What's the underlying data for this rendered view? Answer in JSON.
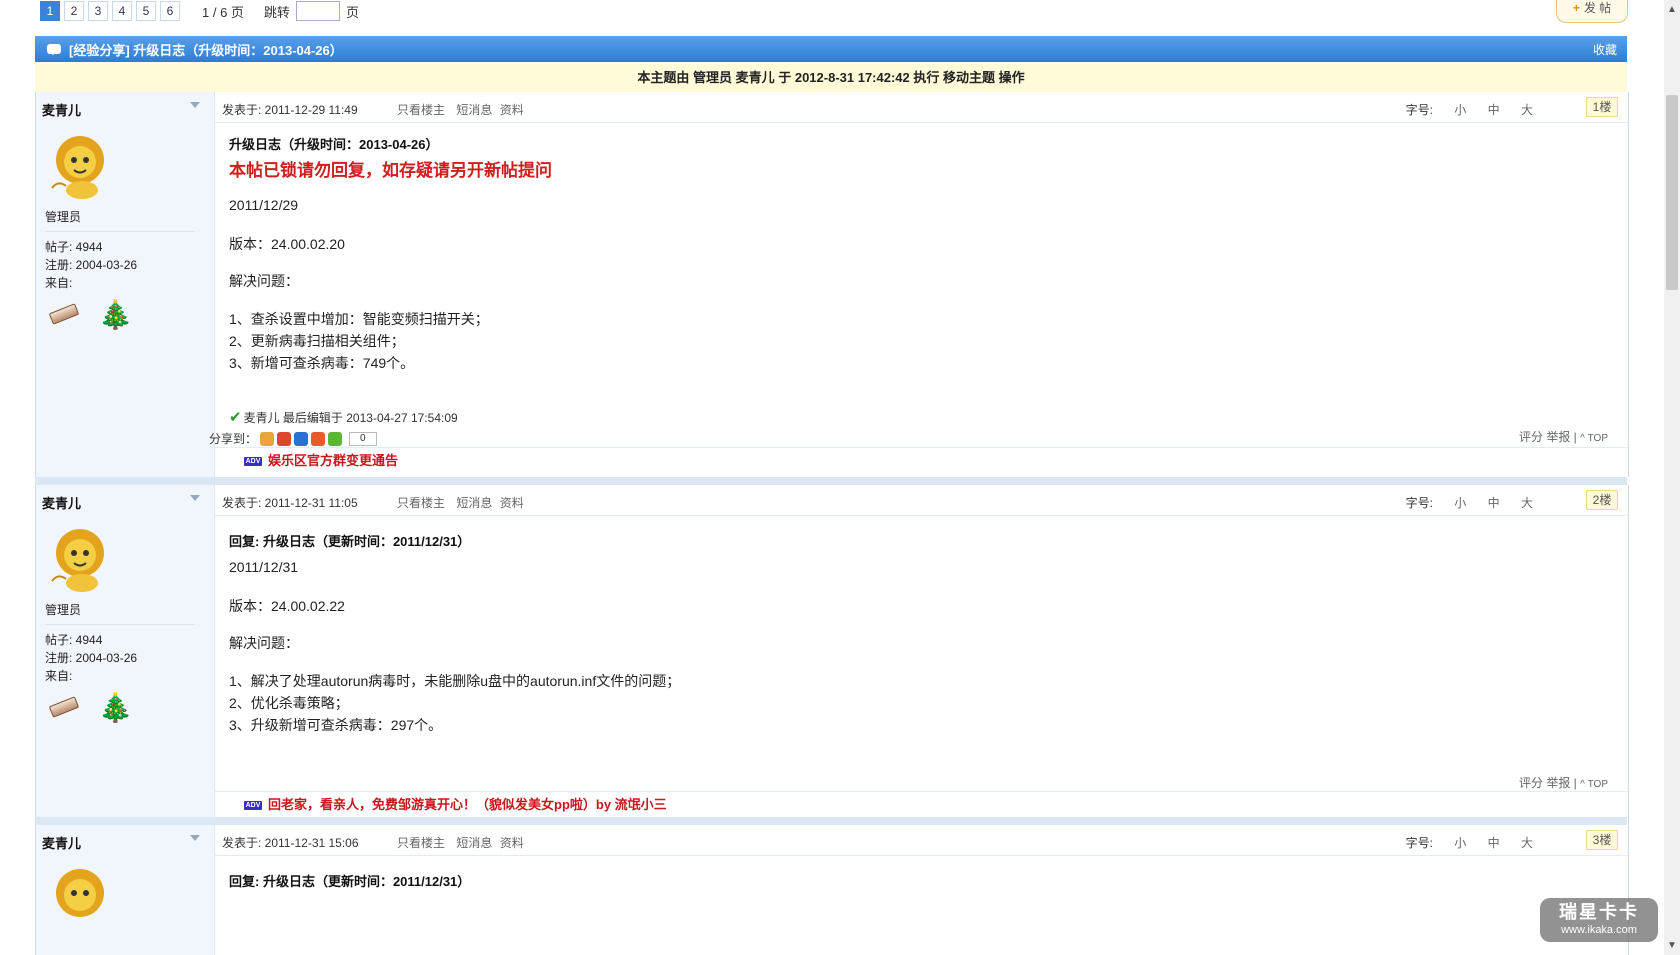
{
  "pager": {
    "pages": [
      "1",
      "2",
      "3",
      "4",
      "5",
      "6"
    ],
    "current": "1",
    "info": "1 / 6 页",
    "jump_label": "跳转",
    "jump_suffix": "页"
  },
  "post_button": "发 帖",
  "thread": {
    "title": "[经验分享] 升级日志（升级时间：2013-04-26）",
    "favorite": "收藏",
    "mod_notice": "本主题由 管理员 麦青儿 于 2012-8-31 17:42:42 执行 移动主题 操作"
  },
  "labels": {
    "only_author": "只看楼主",
    "message": "短消息",
    "profile": "资料",
    "font_size": "字号:",
    "small": "小",
    "medium": "中",
    "large": "大",
    "rate": "评分",
    "report": "举报",
    "sep": "|",
    "top": "^ TOP",
    "share_to": "分享到：",
    "share_count": "0"
  },
  "colors": {
    "bar": "#2d7dd6",
    "red_notice": "#d01e1e",
    "ad_text": "#c9161b",
    "side_bg": "#f1f6fd"
  },
  "posts": [
    {
      "user": "麦青儿",
      "role": "管理员",
      "posts_count": "帖子: 4944",
      "registered": "注册:  2004-03-26",
      "from": "来自:",
      "time": "发表于:   2011-12-29 11:49",
      "floor": "1楼",
      "title": "升级日志（升级时间：2013-04-26）",
      "notice": "本帖已锁请勿回复，如存疑请另开新帖提问",
      "date": "2011/12/29",
      "version": "版本：24.00.02.20",
      "issues_label": "解决问题：",
      "items": [
        "1、查杀设置中增加：智能变频扫描开关；",
        "2、更新病毒扫描相关组件；",
        "3、新增可查杀病毒：749个。"
      ],
      "edited": "麦青儿  最后编辑于  2013-04-27 17:54:09",
      "ad": "娱乐区官方群变更通告"
    },
    {
      "user": "麦青儿",
      "role": "管理员",
      "posts_count": "帖子: 4944",
      "registered": "注册:  2004-03-26",
      "from": "来自:",
      "time": "发表于:   2011-12-31 11:05",
      "floor": "2楼",
      "title": "回复: 升级日志（更新时间：2011/12/31）",
      "date": "2011/12/31",
      "version": "版本：24.00.02.22",
      "issues_label": "解决问题：",
      "items": [
        "1、解决了处理autorun病毒时，未能删除u盘中的autorun.inf文件的问题；",
        "2、优化杀毒策略；",
        "3、升级新增可查杀病毒：297个。"
      ],
      "ad": "回老家，看亲人，免费邹游真开心！（貌似发美女pp啦）by 流氓小三"
    },
    {
      "user": "麦青儿",
      "time": "发表于:   2011-12-31 15:06",
      "floor": "3楼",
      "title": "回复: 升级日志（更新时间：2011/12/31）"
    }
  ],
  "watermark": {
    "line1": "瑞星卡卡",
    "line2": "www.ikaka.com"
  }
}
